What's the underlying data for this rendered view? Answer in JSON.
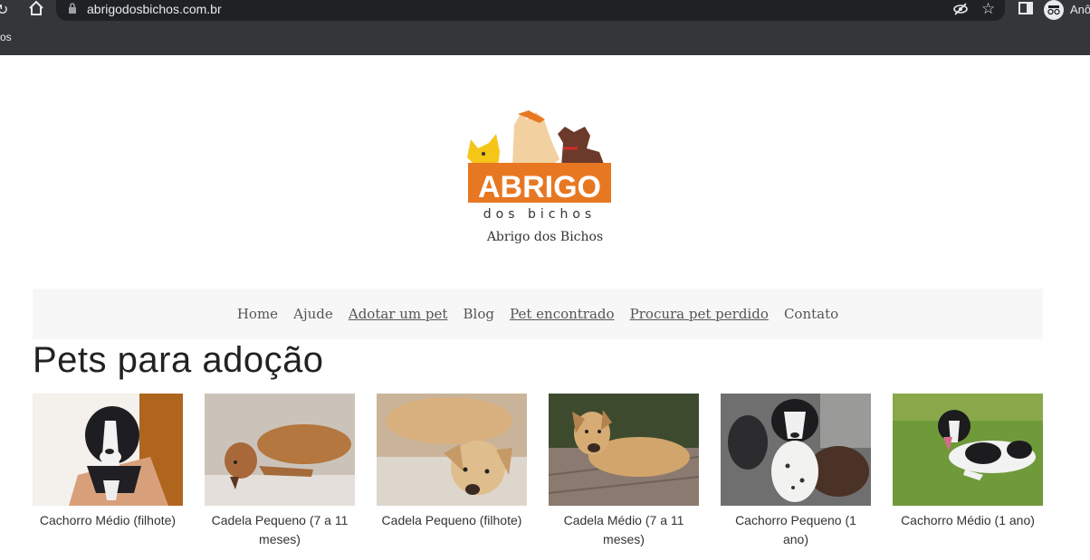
{
  "browser": {
    "url": "abrigodosbichos.com.br",
    "bookmark_fragment": "os",
    "profile_label": "Anô"
  },
  "site": {
    "logo_text": "ABRIGO",
    "logo_subtext": "dos bichos",
    "title": "Abrigo dos Bichos",
    "brand_color": "#e87722"
  },
  "nav": {
    "items": [
      "Home",
      "Ajude",
      "Adotar um pet",
      "Blog",
      "Pet encontrado",
      "Procura pet perdido",
      "Contato"
    ]
  },
  "page": {
    "heading": "Pets para adoção"
  },
  "pets": [
    {
      "caption": "Cachorro Médio (filhote)"
    },
    {
      "caption": "Cadela Pequeno (7 a 11 meses)"
    },
    {
      "caption": "Cadela Pequeno (filhote)"
    },
    {
      "caption": "Cadela Médio (7 a 11 meses)"
    },
    {
      "caption": "Cachorro Pequeno (1 ano)"
    },
    {
      "caption": "Cachorro Médio (1 ano)"
    }
  ]
}
